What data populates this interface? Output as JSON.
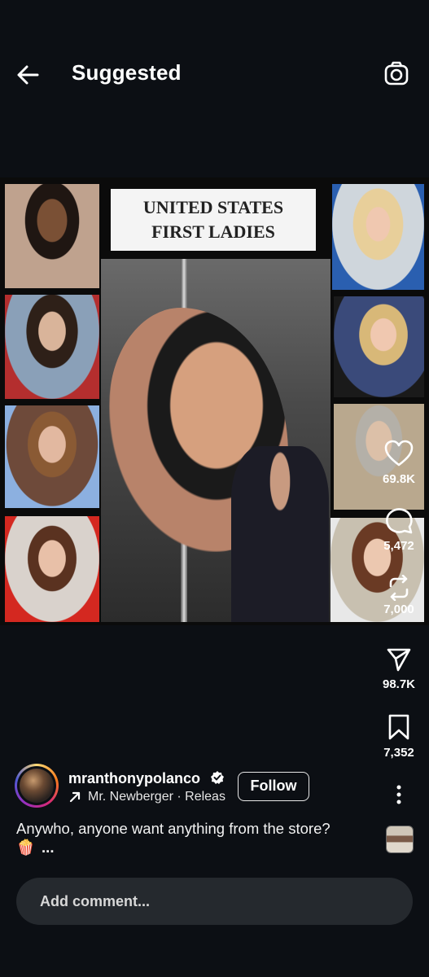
{
  "header": {
    "title": "Suggested",
    "back_icon": "arrow-left-icon",
    "camera_icon": "camera-icon"
  },
  "media": {
    "banner_line1": "UNITED STATES",
    "banner_line2": "FIRST LADIES"
  },
  "actions": {
    "likes": "69.8K",
    "comments": "5,472",
    "reposts": "7,000",
    "shares": "98.7K",
    "saves": "7,352"
  },
  "post": {
    "username": "mranthonypolanco",
    "audio_text": "Mr. Newberger · Releas",
    "follow_label": "Follow",
    "caption": "Anywho, anyone want anything from the store?",
    "caption_emoji": "🍿",
    "caption_more": "..."
  },
  "comment": {
    "placeholder": "Add comment..."
  },
  "colors": {
    "background": "#0c0f14",
    "comment_bar": "#25292e"
  }
}
